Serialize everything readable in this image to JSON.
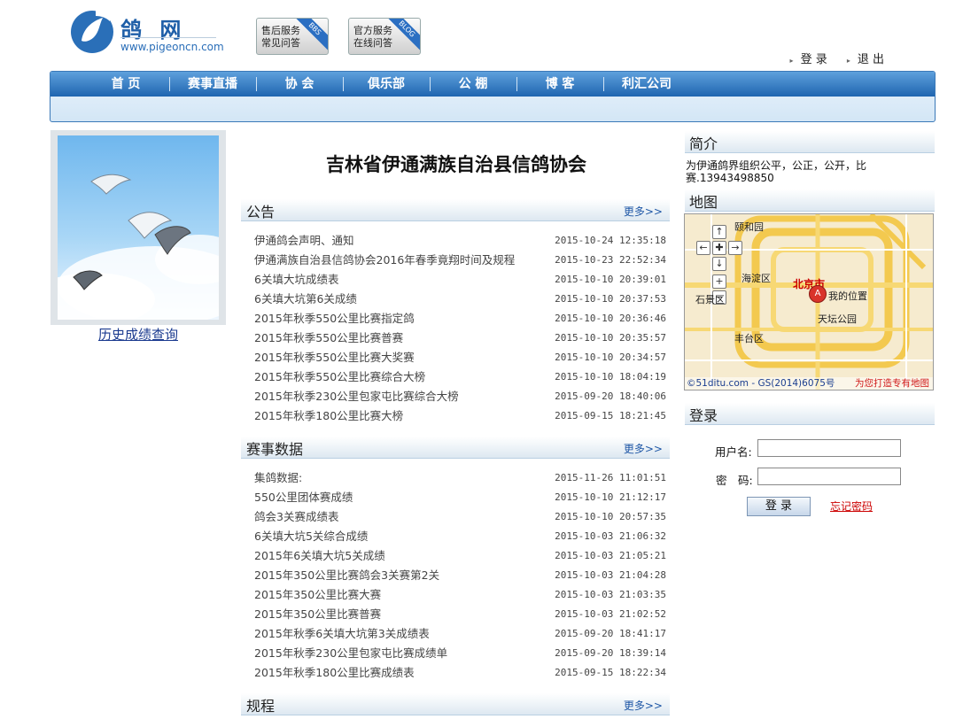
{
  "header": {
    "logo_text": "鸽 网",
    "logo_url": "www.pigeoncn.com",
    "services": [
      {
        "line1": "售后服务",
        "line2": "常见问答",
        "tag": "BBS"
      },
      {
        "line1": "官方服务",
        "line2": "在线问答",
        "tag": "BLOG"
      }
    ],
    "top_links": [
      "登 录",
      "退 出"
    ]
  },
  "nav": {
    "items": [
      "首 页",
      "赛事直播",
      "协 会",
      "俱乐部",
      "公 棚",
      "博 客",
      "利汇公司"
    ]
  },
  "left": {
    "history_link": "历史成绩查询"
  },
  "main": {
    "org_title": "吉林省伊通满族自治县信鸽协会",
    "more_label": "更多>>",
    "sections": [
      {
        "title": "公告",
        "rows": [
          {
            "title": "伊通鸽会声明、通知",
            "date": "2015-10-24 12:35:18"
          },
          {
            "title": "伊通满族自治县信鸽协会2016年春季竟翔时间及规程",
            "date": "2015-10-23 22:52:34"
          },
          {
            "title": "6关填大坑成绩表",
            "date": "2015-10-10 20:39:01"
          },
          {
            "title": "6关填大坑第6关成绩",
            "date": "2015-10-10 20:37:53"
          },
          {
            "title": "2015年秋季550公里比赛指定鸽",
            "date": "2015-10-10 20:36:46"
          },
          {
            "title": "2015年秋季550公里比赛普赛",
            "date": "2015-10-10 20:35:57"
          },
          {
            "title": "2015年秋季550公里比赛大奖赛",
            "date": "2015-10-10 20:34:57"
          },
          {
            "title": "2015年秋季550公里比赛综合大榜",
            "date": "2015-10-10 18:04:19"
          },
          {
            "title": "2015年秋季230公里包家屯比赛综合大榜",
            "date": "2015-09-20 18:40:06"
          },
          {
            "title": "2015年秋季180公里比赛大榜",
            "date": "2015-09-15 18:21:45"
          }
        ]
      },
      {
        "title": "赛事数据",
        "rows": [
          {
            "title": "集鸽数据:",
            "date": "2015-11-26 11:01:51"
          },
          {
            "title": "550公里团体赛成绩",
            "date": "2015-10-10 21:12:17"
          },
          {
            "title": "鸽会3关赛成绩表",
            "date": "2015-10-10 20:57:35"
          },
          {
            "title": "6关填大坑5关综合成绩",
            "date": "2015-10-03 21:06:32"
          },
          {
            "title": "2015年6关填大坑5关成绩",
            "date": "2015-10-03 21:05:21"
          },
          {
            "title": "2015年350公里比赛鸽会3关赛第2关",
            "date": "2015-10-03 21:04:28"
          },
          {
            "title": "2015年350公里比赛大赛",
            "date": "2015-10-03 21:03:35"
          },
          {
            "title": "2015年350公里比赛普赛",
            "date": "2015-10-03 21:02:52"
          },
          {
            "title": "2015年秋季6关填大坑第3关成绩表",
            "date": "2015-09-20 18:41:17"
          },
          {
            "title": "2015年秋季230公里包家屯比赛成绩单",
            "date": "2015-09-20 18:39:14"
          },
          {
            "title": "2015年秋季180公里比赛成绩表",
            "date": "2015-09-15 18:22:34"
          }
        ]
      },
      {
        "title": "规程",
        "rows": []
      }
    ]
  },
  "sidebar": {
    "intro_title": "简介",
    "intro_text": "为伊通鸽界组织公平，公正，公开，比赛.13943498850",
    "map_title": "地图",
    "map": {
      "labels": [
        "颐和园",
        "海淀区",
        "北京市",
        "我的位置",
        "天坛公园",
        "丰台区",
        "石景区"
      ],
      "pin": "A",
      "footer_left": "©51ditu.com - GS(2014)6075号",
      "footer_right": "为您打造专有地图"
    },
    "login_title": "登录",
    "login": {
      "username_label": "用户名:",
      "password_label": "密　码:",
      "submit": "登 录",
      "forgot": "忘记密码"
    }
  }
}
